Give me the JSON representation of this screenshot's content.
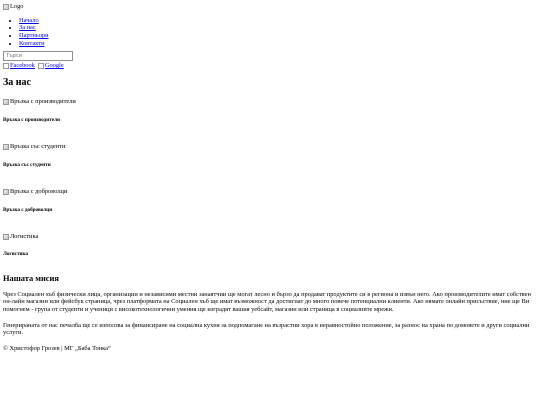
{
  "header": {
    "logo_alt": "Logo"
  },
  "nav": {
    "items": [
      "Начало",
      "За нас",
      "Партньори",
      "Контакти"
    ]
  },
  "search": {
    "placeholder": "Търси"
  },
  "social": {
    "facebook": "Facebook",
    "google": "Google"
  },
  "about": {
    "title": "За нас",
    "features": [
      {
        "img_alt": "Връзка с производители",
        "heading": "Връзка с производители"
      },
      {
        "img_alt": "Връзка със студенти",
        "heading": "Връзка със студенти"
      },
      {
        "img_alt": "Връзка с доброволци",
        "heading": "Връзка с доброволци"
      },
      {
        "img_alt": "Логистика",
        "heading": "Логистика"
      }
    ]
  },
  "mission": {
    "title": "Нашата мисия",
    "paragraph1": "Чрез Социален хъб физически лица, организации и независими местни занаятчии ще могат лесно и бързо да продават продуктите си в региона и извън него. Ако производителите имат собствен он-лайн магазин или фейсбук страница, чрез платформата на Социален хъб ще имат възможност да достигнат до много повече потенциални клиенти. Ако нямате онлайн присъствие, ние ще Ви помогнем - група от студенти и ученици с високотехнологични умения ще изградят вашия уебсайт, магазин или страница в социалните мрежи.",
    "paragraph2": "Генерираната от нас печалба ще се използва за финансиране на социална кухня за подпомагане на възрастни хора в неравностойно положение, за разнос на храна по домовете и други социални услуги."
  },
  "footer": {
    "text": "© Христофор Грозев | МГ „Баба Тонка“"
  }
}
